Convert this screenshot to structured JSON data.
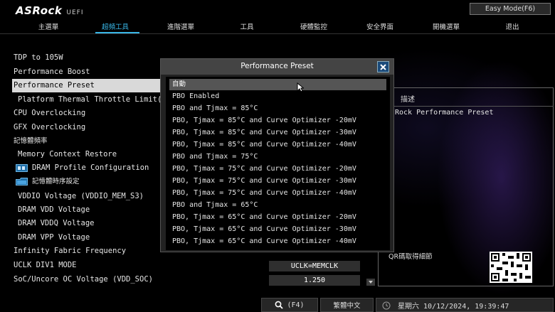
{
  "header": {
    "brand": "ASRock",
    "subtitle": "UEFI",
    "easy_mode_label": "Easy Mode(F6)"
  },
  "tabs": [
    {
      "label": "主選單"
    },
    {
      "label": "超頻工具"
    },
    {
      "label": "進階選單"
    },
    {
      "label": "工具"
    },
    {
      "label": "硬體監控"
    },
    {
      "label": "安全界面"
    },
    {
      "label": "開機選單"
    },
    {
      "label": "退出"
    }
  ],
  "active_tab_index": 1,
  "menu": {
    "items": [
      {
        "label": "TDP to 105W"
      },
      {
        "label": "Performance Boost"
      },
      {
        "label": "Performance Preset"
      },
      {
        "label": "Platform Thermal Throttle Limit("
      },
      {
        "label": "CPU Overclocking"
      },
      {
        "label": "GFX Overclocking"
      },
      {
        "label": "記憶體頻率"
      },
      {
        "label": "Memory Context Restore"
      },
      {
        "label": "DRAM Profile Configuration"
      },
      {
        "label": "記憶體時序設定"
      },
      {
        "label": "VDDIO Voltage (VDDIO_MEM_S3)"
      },
      {
        "label": "DRAM VDD Voltage"
      },
      {
        "label": "DRAM VDDQ Voltage"
      },
      {
        "label": "DRAM VPP Voltage"
      },
      {
        "label": "Infinity Fabric Frequency"
      },
      {
        "label": "UCLK DIV1 MODE"
      },
      {
        "label": "SoC/Uncore OC Voltage (VDD_SOC)"
      }
    ],
    "selected_index": 2
  },
  "values": {
    "uclk_div1_mode": "UCLK=MEMCLK",
    "soc_voltage": "1.250"
  },
  "description": {
    "title": "描述",
    "text": "Rock Performance Preset",
    "qr_hint": "QR碼取得細節"
  },
  "popup": {
    "title": "Performance Preset",
    "selected_index": 0,
    "options": [
      "自動",
      "PBO Enabled",
      "PBO and Tjmax = 85°C",
      "PBO, Tjmax = 85°C and Curve Optimizer -20mV",
      "PBO, Tjmax = 85°C and Curve Optimizer -30mV",
      "PBO, Tjmax = 85°C and Curve Optimizer -40mV",
      "PBO and Tjmax = 75°C",
      "PBO, Tjmax = 75°C and Curve Optimizer -20mV",
      "PBO, Tjmax = 75°C and Curve Optimizer -30mV",
      "PBO, Tjmax = 75°C and Curve Optimizer -40mV",
      "PBO and Tjmax = 65°C",
      "PBO, Tjmax = 65°C and Curve Optimizer -20mV",
      "PBO, Tjmax = 65°C and Curve Optimizer -30mV",
      "PBO, Tjmax = 65°C and Curve Optimizer -40mV"
    ]
  },
  "bottom_bar": {
    "search_label": "(F4)",
    "language": "繁體中文",
    "datetime": "星期六 10/12/2024, 19:39:47"
  },
  "colors": {
    "accent": "#38b6e6",
    "selected_bg": "#d9d9d9",
    "popup_title_bg": "#444444"
  },
  "icons": [
    "close-icon",
    "search-icon",
    "folder-icon",
    "clock-icon",
    "dropdown-arrow-icon",
    "qr-code-icon"
  ]
}
